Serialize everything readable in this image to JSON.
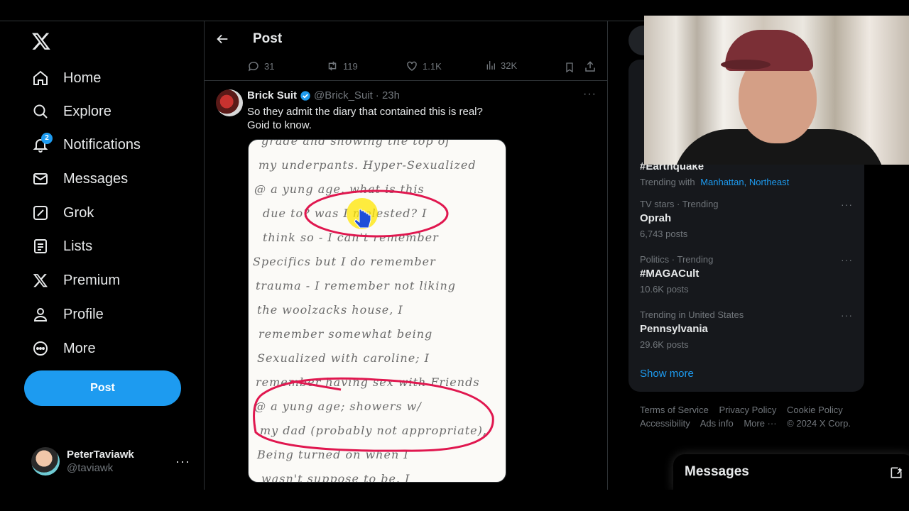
{
  "nav": {
    "items": [
      {
        "label": "Home",
        "icon": "home-icon"
      },
      {
        "label": "Explore",
        "icon": "search-icon"
      },
      {
        "label": "Notifications",
        "icon": "bell-icon"
      },
      {
        "label": "Messages",
        "icon": "mail-icon"
      },
      {
        "label": "Grok",
        "icon": "grok-icon"
      },
      {
        "label": "Lists",
        "icon": "list-icon"
      },
      {
        "label": "Premium",
        "icon": "x-logo-icon"
      },
      {
        "label": "Profile",
        "icon": "person-icon"
      },
      {
        "label": "More",
        "icon": "more-circle-icon"
      }
    ],
    "notifications_badge": "2",
    "post_button": "Post",
    "account": {
      "name": "PeterTaviawk",
      "handle": "@taviawk",
      "more": "···"
    }
  },
  "main": {
    "title": "Post",
    "actions": {
      "replies": "31",
      "reposts": "119",
      "likes": "1.1K",
      "views": "32K"
    },
    "tweet": {
      "author": "Brick Suit",
      "handle": "@Brick_Suit",
      "time": "· 23h",
      "more": "···",
      "text_line1": "So they admit the diary that contained this is real?",
      "text_line2": "Goid to know.",
      "image_lines": [
        "grade and showing the top of",
        "my underpants. Hyper-Sexualized",
        "@ a yung age. what is this",
        "due to? was I molested? I",
        "think so - I can't remember",
        "Specifics but I do remember",
        "trauma - I remember not liking",
        "the woolzacks house, I",
        "remember somewhat being",
        "Sexualized with caroline; I",
        "remember having sex with Friends",
        "@ a yung age; showers w/",
        "my dad (probably not appropriate),",
        "Being turned on when I",
        "wasn't suppose to be. I"
      ]
    }
  },
  "right": {
    "trends": [
      {
        "meta": "",
        "name": "#Earthquake",
        "extra_prefix": "Trending with",
        "extra_links": "Manhattan, Northeast"
      },
      {
        "meta": "TV stars · Trending",
        "name": "Oprah",
        "posts": "6,743 posts"
      },
      {
        "meta": "Politics · Trending",
        "name": "#MAGACult",
        "posts": "10.6K posts"
      },
      {
        "meta": "Trending in United States",
        "name": "Pennsylvania",
        "posts": "29.6K posts"
      }
    ],
    "trend_more": "···",
    "show_more": "Show more",
    "footer": {
      "terms": "Terms of Service",
      "privacy": "Privacy Policy",
      "cookie": "Cookie Policy",
      "accessibility": "Accessibility",
      "ads": "Ads info",
      "more": "More ···",
      "copyright": "© 2024 X Corp."
    },
    "messages_drawer": "Messages"
  },
  "colors": {
    "accent": "#1d9bf0",
    "background": "#000000",
    "muted": "#71767b",
    "text": "#e7e9ea",
    "ink_circle": "#e0174f"
  }
}
